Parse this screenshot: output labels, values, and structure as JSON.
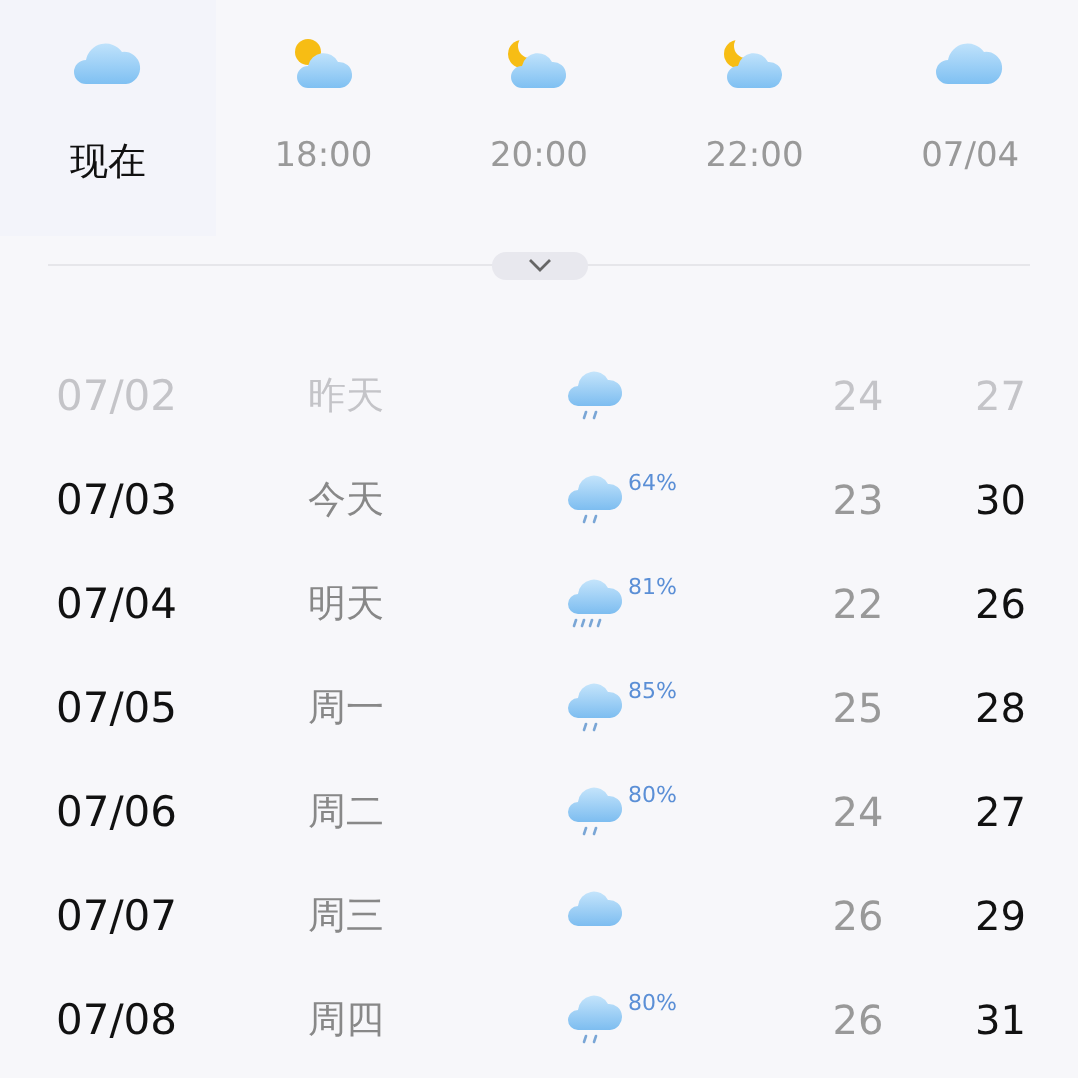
{
  "hourly": [
    {
      "label": "现在",
      "kind": "cloud",
      "selected": true
    },
    {
      "label": "18:00",
      "kind": "sun",
      "selected": false
    },
    {
      "label": "20:00",
      "kind": "moon",
      "selected": false
    },
    {
      "label": "22:00",
      "kind": "moon",
      "selected": false
    },
    {
      "label": "07/04",
      "kind": "cloud",
      "selected": false
    }
  ],
  "daily": [
    {
      "date": "07/02",
      "day": "昨天",
      "kind": "rain",
      "low": "24",
      "high": "27",
      "past": true
    },
    {
      "date": "07/03",
      "day": "今天",
      "kind": "rain",
      "precip": "64%",
      "low": "23",
      "high": "30",
      "past": false
    },
    {
      "date": "07/04",
      "day": "明天",
      "kind": "downpour",
      "precip": "81%",
      "low": "22",
      "high": "26",
      "past": false
    },
    {
      "date": "07/05",
      "day": "周一",
      "kind": "rain",
      "precip": "85%",
      "low": "25",
      "high": "28",
      "past": false
    },
    {
      "date": "07/06",
      "day": "周二",
      "kind": "rain",
      "precip": "80%",
      "low": "24",
      "high": "27",
      "past": false
    },
    {
      "date": "07/07",
      "day": "周三",
      "kind": "cloud",
      "low": "26",
      "high": "29",
      "past": false
    },
    {
      "date": "07/08",
      "day": "周四",
      "kind": "rain",
      "precip": "80%",
      "low": "26",
      "high": "31",
      "past": false
    }
  ]
}
